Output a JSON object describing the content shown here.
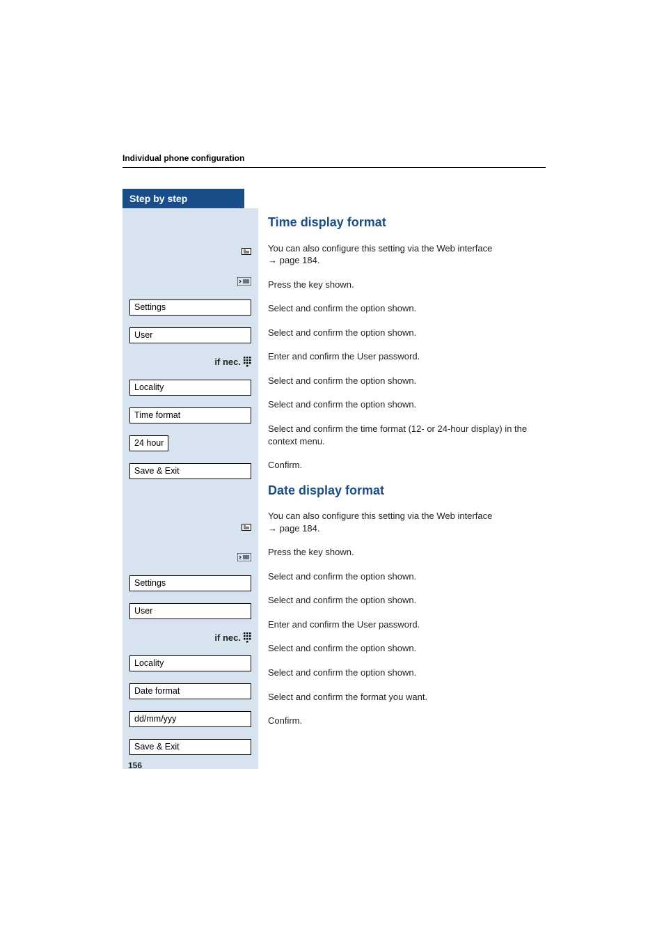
{
  "header": {
    "section": "Individual phone configuration",
    "step_by_step": "Step by step"
  },
  "page_number": "156",
  "sections": [
    {
      "heading": "Time display format",
      "note_pre": "You can also configure this setting via the Web interface ",
      "note_arrow": "→",
      "note_post": " page 184.",
      "rows": [
        {
          "left_type": "icon",
          "left_icon": "menu-list-icon",
          "right": "Press the key shown."
        },
        {
          "left_type": "option",
          "left_text": "Settings",
          "right": "Select and confirm the option shown."
        },
        {
          "left_type": "option",
          "left_text": "User",
          "right": "Select and confirm the option shown."
        },
        {
          "left_type": "prefix",
          "left_prefix": "if nec.",
          "left_icon": "keypad-icon",
          "right": "Enter and confirm the User password."
        },
        {
          "left_type": "option",
          "left_text": "Locality",
          "right": "Select and confirm the option shown."
        },
        {
          "left_type": "option",
          "left_text": "Time format",
          "right": "Select and confirm the option shown."
        },
        {
          "left_type": "option",
          "left_text": "24 hour",
          "right": "Select and confirm the time format (12- or 24-hour display) in the context menu."
        },
        {
          "left_type": "option",
          "left_text": "Save & Exit",
          "right": "Confirm."
        }
      ]
    },
    {
      "heading": "Date display format",
      "note_pre": "You can also configure this setting via the Web interface ",
      "note_arrow": "→",
      "note_post": " page 184.",
      "rows": [
        {
          "left_type": "icon",
          "left_icon": "menu-list-icon",
          "right": "Press the key shown."
        },
        {
          "left_type": "option",
          "left_text": "Settings",
          "right": "Select and confirm the option shown."
        },
        {
          "left_type": "option",
          "left_text": "User",
          "right": "Select and confirm the option shown."
        },
        {
          "left_type": "prefix",
          "left_prefix": "if nec.",
          "left_icon": "keypad-icon",
          "right": "Enter and confirm the User password."
        },
        {
          "left_type": "option",
          "left_text": "Locality",
          "right": "Select and confirm the option shown."
        },
        {
          "left_type": "option",
          "left_text": "Date format",
          "right": "Select and confirm the option shown."
        },
        {
          "left_type": "option",
          "left_text": "dd/mm/yyy",
          "right": "Select and confirm the format you want."
        },
        {
          "left_type": "option",
          "left_text": "Save & Exit",
          "right": "Confirm."
        }
      ]
    }
  ]
}
